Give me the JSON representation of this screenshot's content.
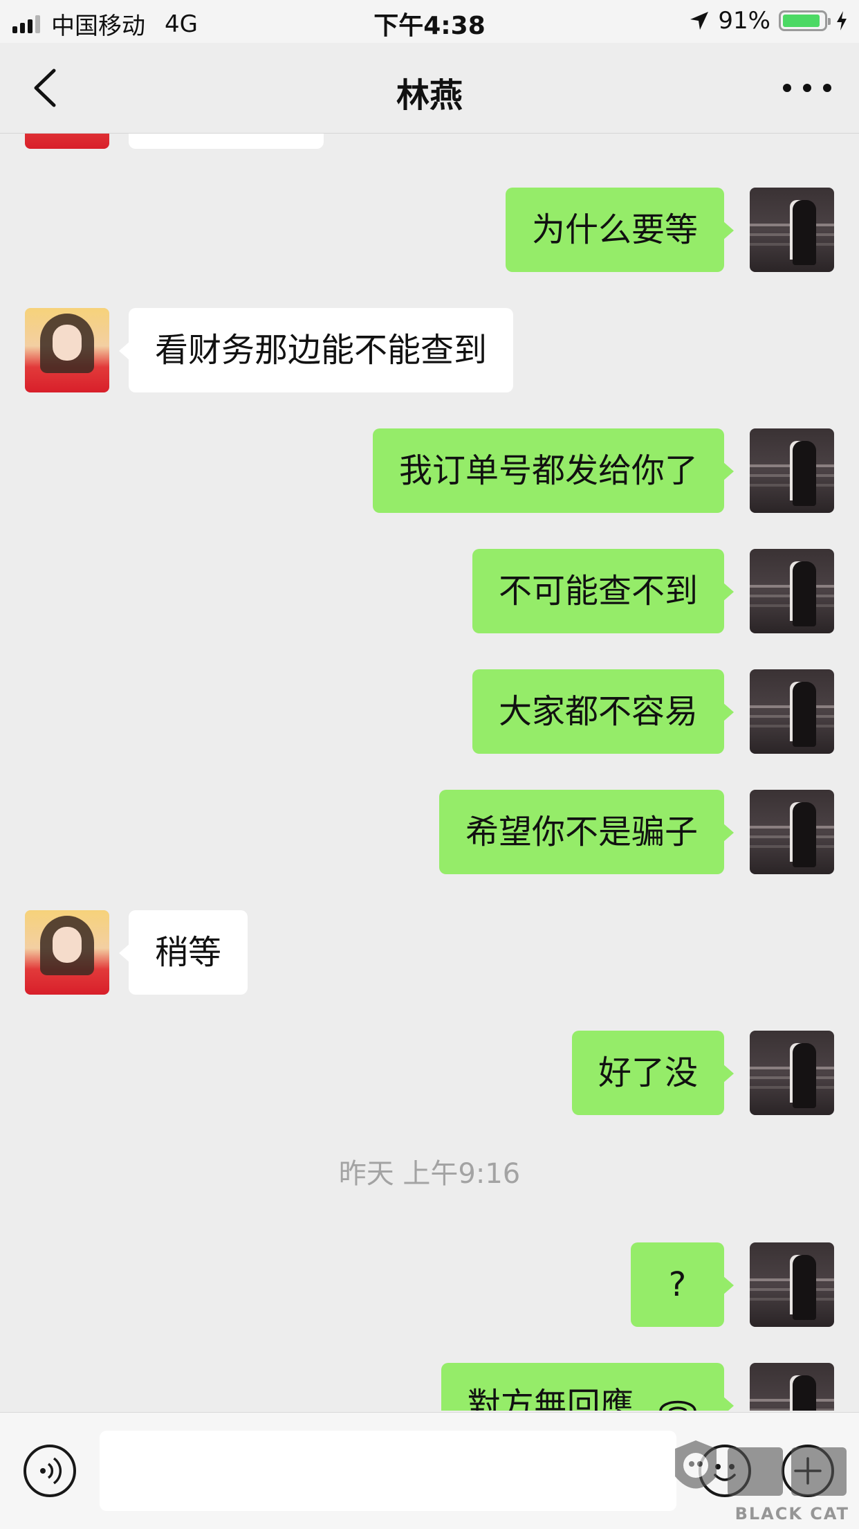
{
  "status_bar": {
    "carrier": "中国移动",
    "network": "4G",
    "time": "下午4:38",
    "battery_percent": "91%",
    "battery_level": 0.91
  },
  "nav": {
    "title": "林燕"
  },
  "messages": [
    {
      "side": "in",
      "text": ""
    },
    {
      "side": "out",
      "text": "为什么要等"
    },
    {
      "side": "in",
      "text": "看财务那边能不能查到"
    },
    {
      "side": "out",
      "text": "我订单号都发给你了"
    },
    {
      "side": "out",
      "text": "不可能查不到"
    },
    {
      "side": "out",
      "text": "大家都不容易"
    },
    {
      "side": "out",
      "text": "希望你不是骗子"
    },
    {
      "side": "in",
      "text": "稍等"
    },
    {
      "side": "out",
      "text": "好了没"
    },
    {
      "type": "timestamp",
      "text": "昨天 上午9:16"
    },
    {
      "side": "out",
      "text": "?"
    },
    {
      "side": "out",
      "text": "對方無回應",
      "icon": "phone-icon"
    }
  ],
  "input": {
    "value": "",
    "placeholder": ""
  },
  "watermark": {
    "text": "BLACK CAT"
  },
  "colors": {
    "background": "#ededed",
    "outgoing_bubble": "#95ec69",
    "incoming_bubble": "#ffffff",
    "battery": "#4cd964"
  }
}
